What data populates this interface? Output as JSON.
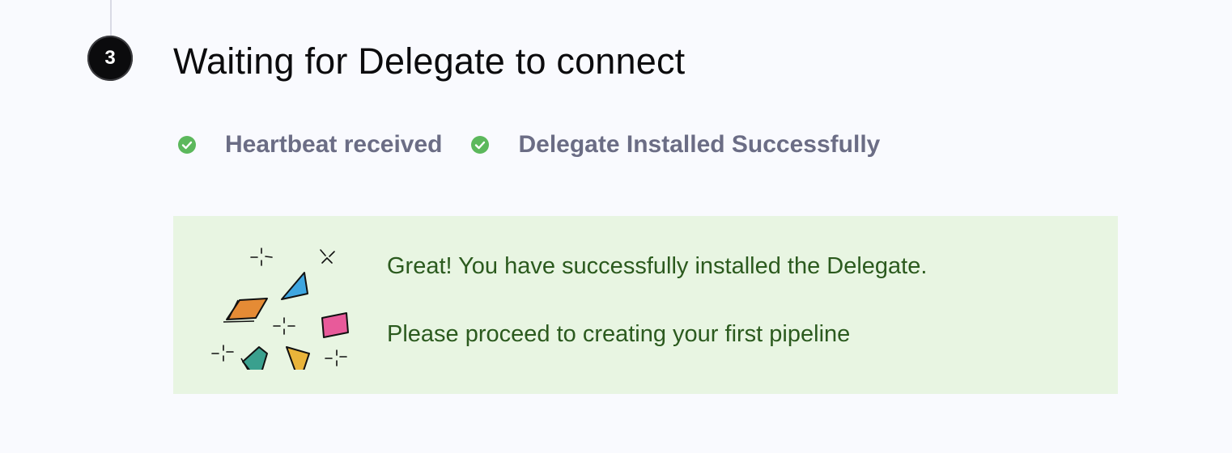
{
  "step": {
    "number": "3",
    "title": "Waiting for Delegate to connect"
  },
  "checks": [
    {
      "label": "Heartbeat received",
      "status": "success",
      "icon": "check-circle-icon"
    },
    {
      "label": "Delegate Installed Successfully",
      "status": "success",
      "icon": "check-circle-icon"
    }
  ],
  "success_box": {
    "illustration": "confetti-icon",
    "line1": "Great! You have successfully installed the Delegate.",
    "line2": "Please proceed to creating your first pipeline"
  },
  "colors": {
    "background": "#f9fafe",
    "success_green": "#5cb85c",
    "success_box_bg": "#e8f5e2",
    "success_text": "#2b5a1e",
    "check_label": "#6b6d85"
  }
}
